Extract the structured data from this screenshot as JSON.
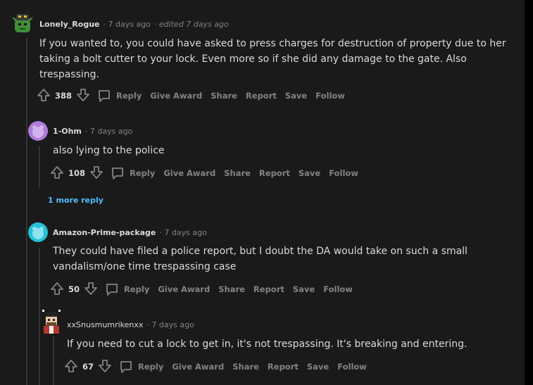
{
  "comments": [
    {
      "author": "Lonely_Rogue",
      "meta": "· 7 days ago",
      "edited": "· edited 7 days ago",
      "body": [
        "If you wanted to, you could have asked to press charges for destruction of property due to her",
        "taking a bolt cutter to your lock. Even more so if she did any damage to the gate. Also",
        "trespassing."
      ],
      "votes": "388"
    },
    {
      "author": "1-Ohm",
      "meta": "· 7 days ago",
      "body": [
        "also lying to the police"
      ],
      "votes": "108"
    },
    {
      "author": "Amazon-Prime-package",
      "meta": "· 7 days ago",
      "body": [
        "They could have filed a police report, but I doubt the DA would take on such a small",
        "vandalism/one time trespassing case"
      ],
      "votes": "50"
    },
    {
      "author": "xxSnusmumrikenxx",
      "meta": "· 7 days ago",
      "body": [
        "If you need to cut a lock to get in, it's not trespassing. It's breaking and entering."
      ],
      "votes": "67"
    }
  ],
  "actions": {
    "reply": "Reply",
    "give_award": "Give Award",
    "share": "Share",
    "report": "Report",
    "save": "Save",
    "follow": "Follow"
  },
  "more_replies": "1 more reply",
  "icons": [
    "upvote-icon",
    "downvote-icon",
    "comment-bubble-icon",
    "avatar"
  ],
  "colors": {
    "background": "#1a1a1b",
    "text": "#d7dadc",
    "meta": "#818384",
    "link": "#4fbcff"
  }
}
